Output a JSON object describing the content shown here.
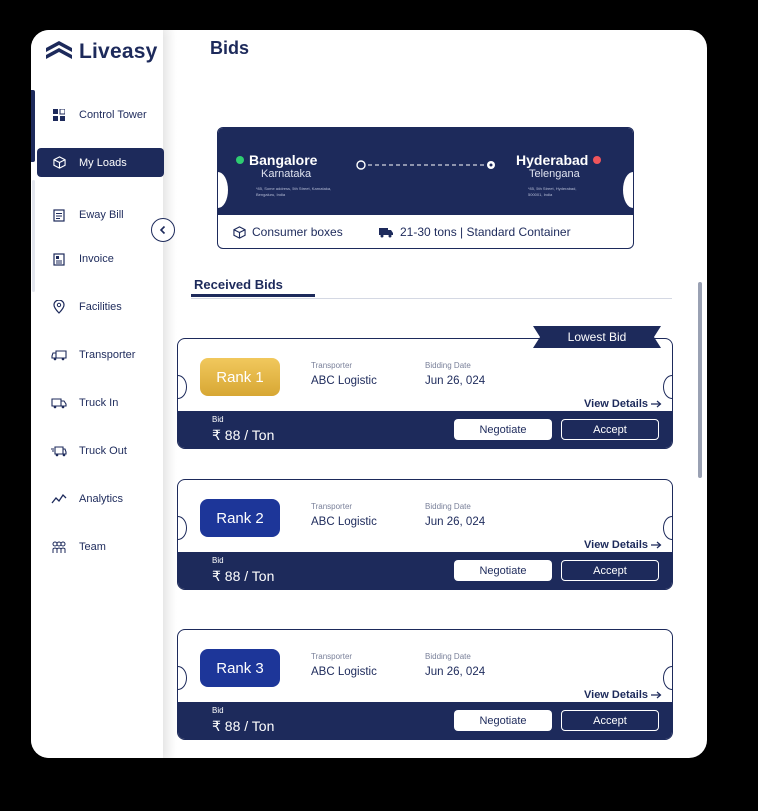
{
  "app": {
    "brand": "Liveasy",
    "page_title": "Bids"
  },
  "sidebar": {
    "items": [
      {
        "label": "Control Tower",
        "icon": "grid-icon"
      },
      {
        "label": "My Loads",
        "icon": "box-icon",
        "active": true
      },
      {
        "label": "Eway Bill",
        "icon": "document-icon"
      },
      {
        "label": "Invoice",
        "icon": "invoice-icon"
      },
      {
        "label": "Facilities",
        "icon": "location-pin-icon"
      },
      {
        "label": "Transporter",
        "icon": "truck-icon"
      },
      {
        "label": "Truck In",
        "icon": "truck-in-icon"
      },
      {
        "label": "Truck Out",
        "icon": "truck-out-icon"
      },
      {
        "label": "Analytics",
        "icon": "analytics-icon"
      },
      {
        "label": "Team",
        "icon": "team-icon"
      }
    ]
  },
  "route": {
    "from_city": "Bangalore",
    "from_state": "Karnataka",
    "from_address": "*85, Some address, 5th Street, Karnataka, Bengaluru, India",
    "to_city": "Hyderabad",
    "to_state": "Telengana",
    "to_address": "*85, 5th Street, Hyderabad, 500001, India",
    "goods": "Consumer boxes",
    "truck": "21-30 tons | Standard Container"
  },
  "tabs": {
    "received_bids": "Received Bids"
  },
  "badge": {
    "lowest_bid": "Lowest Bid"
  },
  "bids": [
    {
      "rank": "Rank 1",
      "transporter_label": "Transporter",
      "transporter": "ABC Logistic",
      "date_label": "Bidding Date",
      "date": "Jun 26, 024",
      "view_details": "View Details",
      "bid_label": "Bid",
      "amount": "₹ 88 / Ton",
      "negotiate": "Negotiate",
      "accept": "Accept"
    },
    {
      "rank": "Rank 2",
      "transporter_label": "Transporter",
      "transporter": "ABC Logistic",
      "date_label": "Bidding Date",
      "date": "Jun 26, 024",
      "view_details": "View Details",
      "bid_label": "Bid",
      "amount": "₹ 88 / Ton",
      "negotiate": "Negotiate",
      "accept": "Accept"
    },
    {
      "rank": "Rank 3",
      "transporter_label": "Transporter",
      "transporter": "ABC Logistic",
      "date_label": "Bidding Date",
      "date": "Jun 26, 024",
      "view_details": "View Details",
      "bid_label": "Bid",
      "amount": "₹ 88 / Ton",
      "negotiate": "Negotiate",
      "accept": "Accept"
    }
  ],
  "colors": {
    "primary": "#1d2a5b",
    "gold": "#e1b443",
    "rank_blue": "#1d3699",
    "origin_dot": "#2ecc71",
    "destination_dot": "#f0555b"
  }
}
